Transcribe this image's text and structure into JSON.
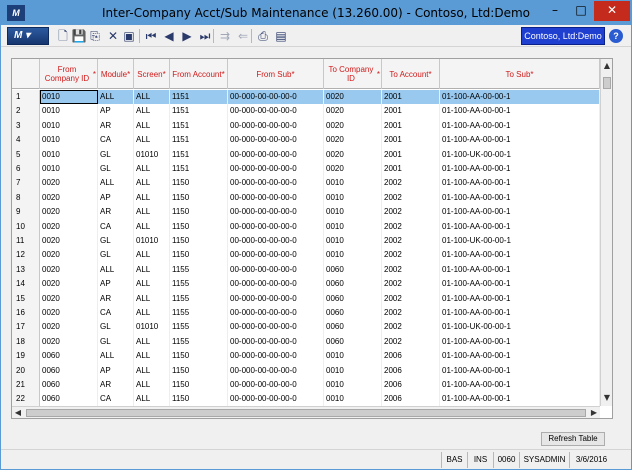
{
  "window": {
    "title": "Inter-Company Acct/Sub Maintenance (13.260.00) - Contoso, Ltd:Demo",
    "minimize_glyph": "–",
    "maximize_glyph": "□",
    "close_glyph": "✕",
    "app_icon": "logo-icon"
  },
  "toolbar": {
    "menu_label": "M ▾",
    "company": "Contoso, Ltd:Demo",
    "help_glyph": "?",
    "buttons": [
      {
        "name": "new-icon",
        "glyph": "🗋"
      },
      {
        "name": "save-icon",
        "glyph": "💾"
      },
      {
        "name": "cancel-icon",
        "glyph": "⎘"
      },
      {
        "name": "delete-icon",
        "glyph": "✕"
      },
      {
        "name": "finish-icon",
        "glyph": "▣"
      },
      {
        "name": "first-icon",
        "glyph": "⏮"
      },
      {
        "name": "previous-icon",
        "glyph": "◀"
      },
      {
        "name": "next-icon",
        "glyph": "▶"
      },
      {
        "name": "last-icon",
        "glyph": "⏭"
      },
      {
        "name": "insert-row-icon",
        "glyph": "⇉"
      },
      {
        "name": "delete-row-icon",
        "glyph": "⇐"
      },
      {
        "name": "print-icon",
        "glyph": "⎙"
      },
      {
        "name": "export-icon",
        "glyph": "▤"
      }
    ]
  },
  "grid": {
    "columns": [
      {
        "key": "num",
        "label": ""
      },
      {
        "key": "from_company",
        "label": "From Company ID",
        "required": "*"
      },
      {
        "key": "module",
        "label": "Module",
        "required": "*"
      },
      {
        "key": "screen",
        "label": "Screen",
        "required": "*"
      },
      {
        "key": "from_account",
        "label": "From Account",
        "required": "*"
      },
      {
        "key": "from_sub",
        "label": "From Sub",
        "required": "*"
      },
      {
        "key": "to_company",
        "label": "To Company ID",
        "required": "*"
      },
      {
        "key": "to_account",
        "label": "To Account",
        "required": "*"
      },
      {
        "key": "to_sub",
        "label": "To Sub",
        "required": "*"
      }
    ],
    "rows": [
      [
        "1",
        "0010",
        "ALL",
        "ALL",
        "1151",
        "00-000-00-00-00-0",
        "0020",
        "2001",
        "01-100-AA-00-00-1"
      ],
      [
        "2",
        "0010",
        "AP",
        "ALL",
        "1151",
        "00-000-00-00-00-0",
        "0020",
        "2001",
        "01-100-AA-00-00-1"
      ],
      [
        "3",
        "0010",
        "AR",
        "ALL",
        "1151",
        "00-000-00-00-00-0",
        "0020",
        "2001",
        "01-100-AA-00-00-1"
      ],
      [
        "4",
        "0010",
        "CA",
        "ALL",
        "1151",
        "00-000-00-00-00-0",
        "0020",
        "2001",
        "01-100-AA-00-00-1"
      ],
      [
        "5",
        "0010",
        "GL",
        "01010",
        "1151",
        "00-000-00-00-00-0",
        "0020",
        "2001",
        "01-100-UK-00-00-1"
      ],
      [
        "6",
        "0010",
        "GL",
        "ALL",
        "1151",
        "00-000-00-00-00-0",
        "0020",
        "2001",
        "01-100-AA-00-00-1"
      ],
      [
        "7",
        "0020",
        "ALL",
        "ALL",
        "1150",
        "00-000-00-00-00-0",
        "0010",
        "2002",
        "01-100-AA-00-00-1"
      ],
      [
        "8",
        "0020",
        "AP",
        "ALL",
        "1150",
        "00-000-00-00-00-0",
        "0010",
        "2002",
        "01-100-AA-00-00-1"
      ],
      [
        "9",
        "0020",
        "AR",
        "ALL",
        "1150",
        "00-000-00-00-00-0",
        "0010",
        "2002",
        "01-100-AA-00-00-1"
      ],
      [
        "10",
        "0020",
        "CA",
        "ALL",
        "1150",
        "00-000-00-00-00-0",
        "0010",
        "2002",
        "01-100-AA-00-00-1"
      ],
      [
        "11",
        "0020",
        "GL",
        "01010",
        "1150",
        "00-000-00-00-00-0",
        "0010",
        "2002",
        "01-100-UK-00-00-1"
      ],
      [
        "12",
        "0020",
        "GL",
        "ALL",
        "1150",
        "00-000-00-00-00-0",
        "0010",
        "2002",
        "01-100-AA-00-00-1"
      ],
      [
        "13",
        "0020",
        "ALL",
        "ALL",
        "1155",
        "00-000-00-00-00-0",
        "0060",
        "2002",
        "01-100-AA-00-00-1"
      ],
      [
        "14",
        "0020",
        "AP",
        "ALL",
        "1155",
        "00-000-00-00-00-0",
        "0060",
        "2002",
        "01-100-AA-00-00-1"
      ],
      [
        "15",
        "0020",
        "AR",
        "ALL",
        "1155",
        "00-000-00-00-00-0",
        "0060",
        "2002",
        "01-100-AA-00-00-1"
      ],
      [
        "16",
        "0020",
        "CA",
        "ALL",
        "1155",
        "00-000-00-00-00-0",
        "0060",
        "2002",
        "01-100-AA-00-00-1"
      ],
      [
        "17",
        "0020",
        "GL",
        "01010",
        "1155",
        "00-000-00-00-00-0",
        "0060",
        "2002",
        "01-100-UK-00-00-1"
      ],
      [
        "18",
        "0020",
        "GL",
        "ALL",
        "1155",
        "00-000-00-00-00-0",
        "0060",
        "2002",
        "01-100-AA-00-00-1"
      ],
      [
        "19",
        "0060",
        "ALL",
        "ALL",
        "1150",
        "00-000-00-00-00-0",
        "0010",
        "2006",
        "01-100-AA-00-00-1"
      ],
      [
        "20",
        "0060",
        "AP",
        "ALL",
        "1150",
        "00-000-00-00-00-0",
        "0010",
        "2006",
        "01-100-AA-00-00-1"
      ],
      [
        "21",
        "0060",
        "AR",
        "ALL",
        "1150",
        "00-000-00-00-00-0",
        "0010",
        "2006",
        "01-100-AA-00-00-1"
      ],
      [
        "22",
        "0060",
        "CA",
        "ALL",
        "1150",
        "00-000-00-00-00-0",
        "0010",
        "2006",
        "01-100-AA-00-00-1"
      ]
    ],
    "selected_row": 1,
    "scroll_up_glyph": "▲",
    "scroll_down_glyph": "▼",
    "scroll_left_glyph": "◀",
    "scroll_right_glyph": "▶"
  },
  "refresh_button": "Refresh Table",
  "statusbar": [
    "BAS",
    "INS",
    "0060",
    "SYSADMIN",
    "3/6/2016"
  ]
}
